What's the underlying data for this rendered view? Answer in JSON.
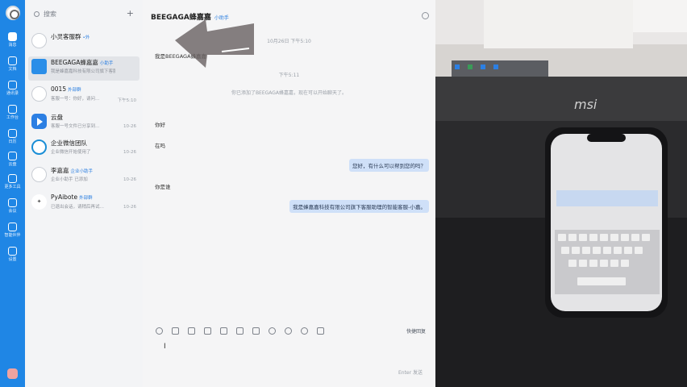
{
  "rail": {
    "items": [
      {
        "label": "消息",
        "active": true
      },
      {
        "label": "文档"
      },
      {
        "label": "通讯录"
      },
      {
        "label": "工作台"
      },
      {
        "label": "日历"
      },
      {
        "label": "云盘"
      },
      {
        "label": "更多工具"
      },
      {
        "label": "会议"
      },
      {
        "label": "智能伙伴"
      },
      {
        "label": "设置"
      }
    ]
  },
  "search": {
    "placeholder": "搜索"
  },
  "conversations": [
    {
      "title": "小灵客服群",
      "tag": "•外",
      "preview": "",
      "time": ""
    },
    {
      "title": "BEEGAGA蜂嘉嘉",
      "tag": "小助手",
      "preview": "我是蜂嘉嘉科技有限公司旗下客服…",
      "time": ""
    },
    {
      "title": "0015",
      "tag": "外部群",
      "preview": "客服一号：你好，请问…",
      "time": "下午5:10"
    },
    {
      "title": "云盘",
      "tag": "",
      "preview": "客服一号文件已分享到…",
      "time": "10-26"
    },
    {
      "title": "企业微信团队",
      "tag": "",
      "preview": "企业微信开始使用了",
      "time": "10-26"
    },
    {
      "title": "李嘉嘉",
      "tag": "企业小助手",
      "preview": "企业小助手 已添加",
      "time": "10-26"
    },
    {
      "title": "PyAibote",
      "tag": "外部群",
      "preview": "已退出会话，请稍后再试…",
      "time": "10-26"
    }
  ],
  "chat": {
    "title": "BEEGAGA蜂嘉嘉",
    "title_tag": "小助手",
    "date_divider": "10月26日 下午5:10",
    "greeting": "我是BEEGAGA蜂嘉嘉",
    "system_notice": "你已添加了BEEGAGA蜂嘉嘉，现在可以开始聊天了。",
    "system_time": "下午5:11",
    "messages": [
      {
        "side": "in",
        "text": "你好"
      },
      {
        "side": "in",
        "text": "在吗"
      },
      {
        "side": "out",
        "text": "您好，有什么可以帮到您的吗？"
      },
      {
        "side": "in",
        "text": "你是谁"
      },
      {
        "side": "out",
        "text": "我是蜂嘉嘉科技有限公司旗下客服助理的智能客服-小嘉。"
      }
    ],
    "quick_phrase": "快捷回复",
    "send_hint": "Enter 发送"
  },
  "photo": {
    "brand": "msi"
  },
  "colors": {
    "rail": "#1f86e5",
    "accent": "#2a7ee0",
    "bubble_out": "#cfe0f8"
  }
}
